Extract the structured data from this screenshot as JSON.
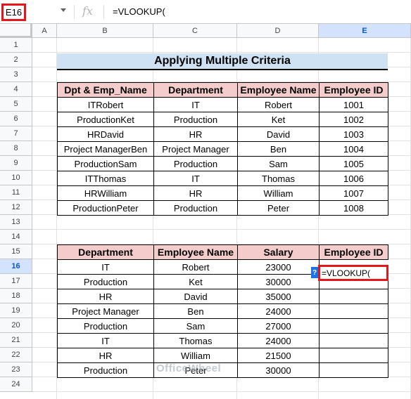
{
  "formula_bar": {
    "cell_ref": "E16",
    "formula": "=VLOOKUP("
  },
  "columns": [
    "A",
    "B",
    "C",
    "D",
    "E"
  ],
  "rows": [
    "1",
    "2",
    "3",
    "4",
    "5",
    "6",
    "7",
    "8",
    "9",
    "10",
    "11",
    "12",
    "13",
    "14",
    "15",
    "16",
    "17",
    "18",
    "19",
    "20",
    "21",
    "22",
    "23",
    "24"
  ],
  "title": "Applying Multiple Criteria",
  "table1": {
    "headers": [
      "Dpt & Emp_Name",
      "Department",
      "Employee Name",
      "Employee ID"
    ],
    "rows": [
      [
        "ITRobert",
        "IT",
        "Robert",
        "1001"
      ],
      [
        "ProductionKet",
        "Production",
        "Ket",
        "1002"
      ],
      [
        "HRDavid",
        "HR",
        "David",
        "1003"
      ],
      [
        "Project ManagerBen",
        "Project Manager",
        "Ben",
        "1004"
      ],
      [
        "ProductionSam",
        "Production",
        "Sam",
        "1005"
      ],
      [
        "ITThomas",
        "IT",
        "Thomas",
        "1006"
      ],
      [
        "HRWilliam",
        "HR",
        "William",
        "1007"
      ],
      [
        "ProductionPeter",
        "Production",
        "Peter",
        "1008"
      ]
    ]
  },
  "table2": {
    "headers": [
      "Department",
      "Employee Name",
      "Salary",
      "Employee ID"
    ],
    "rows": [
      [
        "IT",
        "Robert",
        "23000",
        "=VLOOKUP("
      ],
      [
        "Production",
        "Ket",
        "30000",
        ""
      ],
      [
        "HR",
        "David",
        "35000",
        ""
      ],
      [
        "Project Manager",
        "Ben",
        "24000",
        ""
      ],
      [
        "Production",
        "Sam",
        "27000",
        ""
      ],
      [
        "IT",
        "Thomas",
        "24000",
        ""
      ],
      [
        "HR",
        "William",
        "21500",
        ""
      ],
      [
        "Production",
        "Peter",
        "30000",
        ""
      ]
    ]
  },
  "help_icon": "?",
  "watermark": "OfficeWheel"
}
